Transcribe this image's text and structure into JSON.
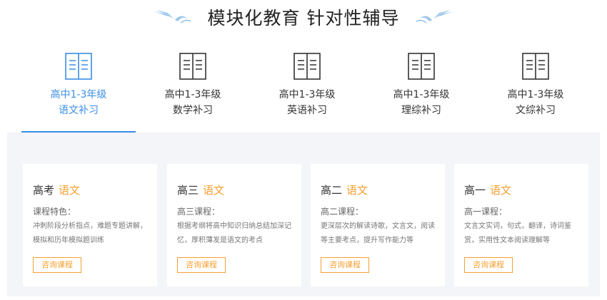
{
  "header": {
    "title": "模块化教育 针对性辅导"
  },
  "colors": {
    "accent_blue": "#3a8ee6",
    "accent_orange": "#f5a030",
    "panel_bg": "#f3f5f8"
  },
  "tabs": [
    {
      "line1": "高中1-3年级",
      "line2": "语文补习",
      "icon": "book-icon",
      "active": true
    },
    {
      "line1": "高中1-3年级",
      "line2": "数学补习",
      "icon": "book-icon",
      "active": false
    },
    {
      "line1": "高中1-3年级",
      "line2": "英语补习",
      "icon": "book-icon",
      "active": false
    },
    {
      "line1": "高中1-3年级",
      "line2": "理综补习",
      "icon": "book-icon",
      "active": false
    },
    {
      "line1": "高中1-3年级",
      "line2": "文综补习",
      "icon": "book-icon",
      "active": false
    }
  ],
  "cards": [
    {
      "title": "高考",
      "subject": "语文",
      "subtitle": "课程特色：",
      "description": "冲刺阶段分析指点，难题专题讲解，模拟和历年模拟题训练",
      "button": "咨询课程"
    },
    {
      "title": "高三",
      "subject": "语文",
      "subtitle": "高三课程：",
      "description": "根据考纲将高中知识归纳总结加深记忆，厚积薄发是语文的考点",
      "button": "咨询课程"
    },
    {
      "title": "高二",
      "subject": "语文",
      "subtitle": "高二课程：",
      "description": "更深层次的解读诗歌，文言文，阅读等主要考点，提升写作能力等",
      "button": "咨询课程"
    },
    {
      "title": "高一",
      "subject": "语文",
      "subtitle": "高一课程：",
      "description": "文言文实词，句式，翻译，诗词鉴赏，实用性文本阅读理解等",
      "button": "咨询课程"
    }
  ]
}
